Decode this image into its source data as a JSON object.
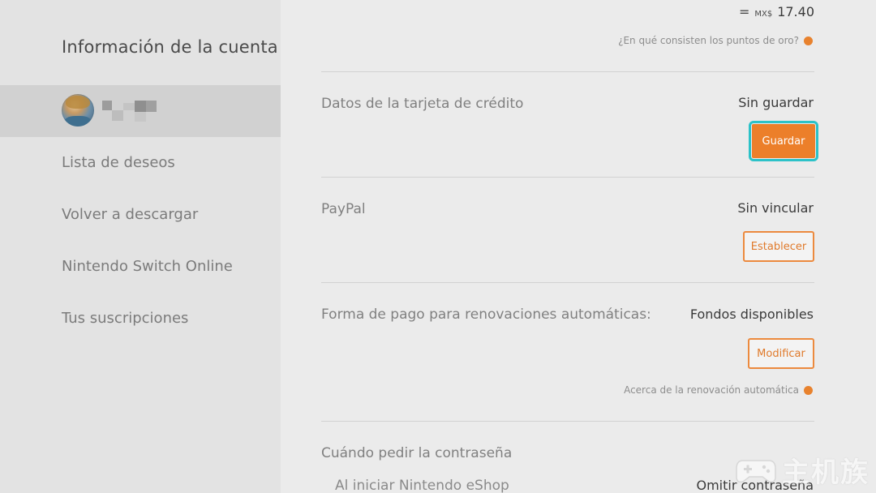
{
  "sidebar": {
    "title": "Información de la cuenta",
    "items": [
      {
        "label": "Lista de deseos"
      },
      {
        "label": "Volver a descargar"
      },
      {
        "label": "Nintendo Switch Online"
      },
      {
        "label": "Tus suscripciones"
      }
    ]
  },
  "main": {
    "balance": {
      "equals": "=",
      "currency": "MX$",
      "amount": "17.40",
      "info_link": "¿En qué consisten los puntos de oro?"
    },
    "credit_card": {
      "label": "Datos de la tarjeta de crédito",
      "status": "Sin guardar",
      "button": "Guardar"
    },
    "paypal": {
      "label": "PayPal",
      "status": "Sin vincular",
      "button": "Establecer"
    },
    "auto_renewal": {
      "label": "Forma de pago para renovaciones automáticas:",
      "status": "Fondos disponibles",
      "button": "Modificar",
      "info_link": "Acerca de la renovación automática"
    },
    "password": {
      "label": "Cuándo pedir la contraseña",
      "sub_label": "Al iniciar Nintendo eShop",
      "value": "Omitir contraseña"
    }
  },
  "watermark": {
    "text": "主机族"
  },
  "colors": {
    "accent": "#ec7f2a",
    "focus": "#2cc2c8",
    "sidebar_bg": "#e3e3e3",
    "selected_bg": "#d1d1d1",
    "main_bg": "#ebebeb"
  }
}
